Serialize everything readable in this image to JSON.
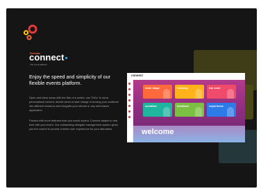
{
  "brand": {
    "small": "Seesaw",
    "name": "connect",
    "tag": "The event platform"
  },
  "content": {
    "headline": "Enjoy the speed and simplicity of our flexible events platform.",
    "paragraph1": "Open and close areas with the flick of a switch, use 'DiGo' to show personalised content, decide when to take charge of moving your audience into different sessions and integrate your stream or any web based application.",
    "paragraph2": "Packed with more features than you would expect, Connect adapts in real time with your event. Our outstanding delegate management system gives you the control to provide a better user experience for your attendees."
  },
  "app": {
    "logo": "connect",
    "tiles": [
      {
        "label": "main stage",
        "color": "#ff6a3d"
      },
      {
        "label": "learning",
        "color": "#ffb21a"
      },
      {
        "label": "fun zone",
        "color": "#f04b6a"
      },
      {
        "label": "socialise",
        "color": "#1fb59f"
      },
      {
        "label": "breakout",
        "color": "#7bc043"
      },
      {
        "label": "experience",
        "color": "#2d7be8"
      }
    ],
    "welcome": "welcome"
  },
  "colors": {
    "background": "#151515",
    "accent_orange": "#ff6a3d",
    "accent_yellow": "#ffcc00",
    "accent_red": "#e43a3a",
    "accent_blue": "#36b7ff"
  }
}
